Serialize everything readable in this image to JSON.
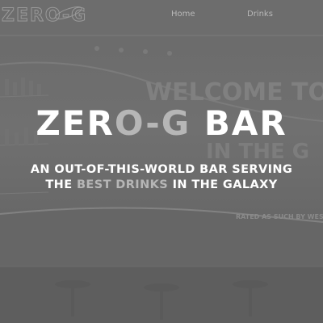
{
  "brand": {
    "logo_text": "ZERO-G",
    "accent_color": "#b6b6b6",
    "text_color": "#ffffff"
  },
  "nav": {
    "items": [
      {
        "label": "Home"
      },
      {
        "label": "Drinks"
      }
    ]
  },
  "hero": {
    "title_main": "ZER",
    "title_accent": "O-G",
    "title_end": " BAR",
    "tagline_pre": "AN OUT-OF-THIS-WORLD BAR SERVING THE ",
    "tagline_accent": "BEST DRINKS",
    "tagline_post": " IN THE GALAXY",
    "background": {
      "wall_sign_line1": "WELCOME TO T",
      "wall_sign_line2": "IN THE G",
      "wall_caption": "RATED AS SUCH BY WESTWO"
    }
  }
}
